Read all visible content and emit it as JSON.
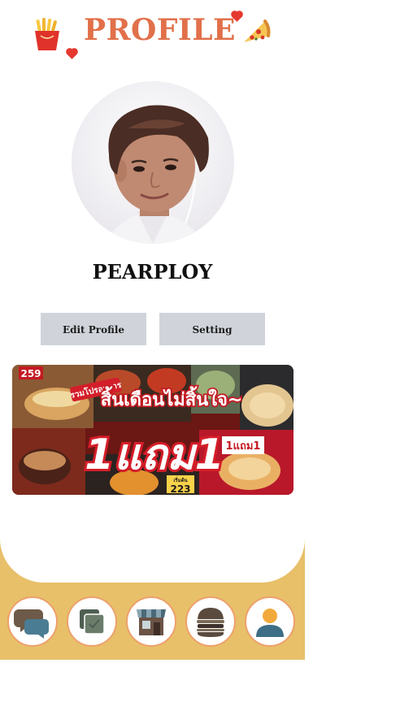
{
  "header": {
    "title": "PROFILE",
    "left_icon": "fries-icon",
    "right_icon": "pizza-slice-icon"
  },
  "profile": {
    "username": "PEARPLOY",
    "avatar_icon": "avatar-photo"
  },
  "actions": {
    "edit_profile_label": "Edit Profile",
    "setting_label": "Setting"
  },
  "banner": {
    "top_tag": "รวมโปรอาหาร",
    "headline": "สิ้นเดือนไม่สิ้นใจ~",
    "offer": "1แถม1",
    "small_offer": "1แถม1",
    "price_left": "259",
    "price_right": "223",
    "price_caption": "เริ่มต้น"
  },
  "bottom_nav": {
    "items": [
      {
        "icon": "chat-bubbles-icon"
      },
      {
        "icon": "stacked-cards-icon"
      },
      {
        "icon": "shop-icon"
      },
      {
        "icon": "burger-icon"
      },
      {
        "icon": "user-icon"
      }
    ]
  },
  "colors": {
    "accent": "#e1704a",
    "nav_background": "#e8c06a",
    "nav_button_border": "#eda06b",
    "button_background": "#d0d4da"
  }
}
